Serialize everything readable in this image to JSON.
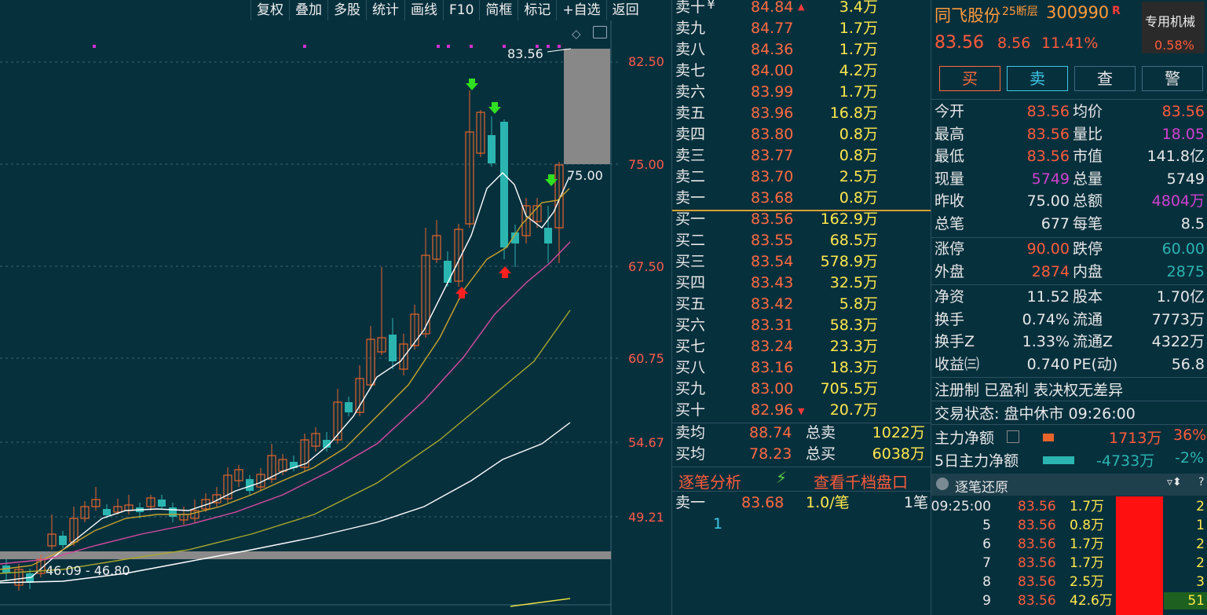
{
  "toolbar": [
    "复权",
    "叠加",
    "多股",
    "统计",
    "画线",
    "F10",
    "简框",
    "标记",
    "+自选",
    "返回"
  ],
  "chart": {
    "y_labels": [
      "82.50",
      "75.00",
      "67.50",
      "60.75",
      "54.67",
      "49.21"
    ],
    "max_label": "83.56",
    "marker_label": "75.00",
    "range_label": "46.09 - 46.80",
    "colors": {
      "up": "#e8642a",
      "down": "#2bb5b0",
      "ma5": "#ffffff",
      "ma10": "#c8a42a",
      "ma20": "#d84aa0",
      "ma30": "#a8a82a",
      "ma60": "#ffffff"
    }
  },
  "chart_data": {
    "type": "candlestick",
    "y_axis_ticks": [
      82.5,
      75.0,
      67.5,
      60.75,
      54.67,
      49.21
    ],
    "max_price": 83.56,
    "close_marker": 75.0,
    "min_range": "46.09 - 46.80"
  },
  "book": {
    "sell": [
      {
        "name": "卖十",
        "px": "84.84",
        "vol": "3.4万"
      },
      {
        "name": "卖九",
        "px": "84.77",
        "vol": "1.7万"
      },
      {
        "name": "卖八",
        "px": "84.36",
        "vol": "1.7万"
      },
      {
        "name": "卖七",
        "px": "84.00",
        "vol": "4.2万"
      },
      {
        "name": "卖六",
        "px": "83.99",
        "vol": "1.7万"
      },
      {
        "name": "卖五",
        "px": "83.96",
        "vol": "16.8万"
      },
      {
        "name": "卖四",
        "px": "83.80",
        "vol": "0.8万"
      },
      {
        "name": "卖三",
        "px": "83.77",
        "vol": "0.8万"
      },
      {
        "name": "卖二",
        "px": "83.70",
        "vol": "2.5万"
      },
      {
        "name": "卖一",
        "px": "83.68",
        "vol": "0.8万"
      }
    ],
    "sell_top_mark": "¥",
    "buy": [
      {
        "name": "买一",
        "px": "83.56",
        "vol": "162.9万"
      },
      {
        "name": "买二",
        "px": "83.55",
        "vol": "68.5万"
      },
      {
        "name": "买三",
        "px": "83.54",
        "vol": "578.9万"
      },
      {
        "name": "买四",
        "px": "83.43",
        "vol": "32.5万"
      },
      {
        "name": "买五",
        "px": "83.42",
        "vol": "5.8万"
      },
      {
        "name": "买六",
        "px": "83.31",
        "vol": "58.3万"
      },
      {
        "name": "买七",
        "px": "83.24",
        "vol": "23.3万"
      },
      {
        "name": "买八",
        "px": "83.16",
        "vol": "18.3万"
      },
      {
        "name": "买九",
        "px": "83.00",
        "vol": "705.5万"
      },
      {
        "name": "买十",
        "px": "82.96",
        "vol": "20.7万"
      }
    ],
    "avg_sell_label": "卖均",
    "avg_sell": "88.74",
    "total_sell_label": "总卖",
    "total_sell": "1022万",
    "avg_buy_label": "买均",
    "avg_buy": "78.23",
    "total_buy_label": "总买",
    "total_buy": "6038万",
    "tab_analysis": "逐笔分析",
    "tab_levels": "查看千档盘口",
    "detail_name": "卖一",
    "detail_px": "83.68",
    "detail_per": "1.0/笔",
    "detail_cnt": "1笔",
    "detail_queue": "1"
  },
  "quote": {
    "name": "同飞股份",
    "tag": "25断层",
    "code": "300990",
    "r_mark": "R",
    "sector": "专用机械",
    "sector_pct": "0.58%",
    "price": "83.56",
    "change": "8.56",
    "pct": "11.41%",
    "buttons": [
      "买",
      "卖",
      "查",
      "警"
    ],
    "stats": [
      [
        "今开",
        "83.56",
        "均价",
        "83.56"
      ],
      [
        "最高",
        "83.56",
        "量比",
        "18.05"
      ],
      [
        "最低",
        "83.56",
        "市值",
        "141.8亿"
      ],
      [
        "现量",
        "5749",
        "总量",
        "5749"
      ],
      [
        "昨收",
        "75.00",
        "总额",
        "4804万"
      ],
      [
        "总笔",
        "677",
        "每笔",
        "8.5"
      ]
    ],
    "limits": [
      [
        "涨停",
        "90.00",
        "跌停",
        "60.00"
      ],
      [
        "外盘",
        "2874",
        "内盘",
        "2875"
      ]
    ],
    "fund": [
      [
        "净资",
        "11.52",
        "股本",
        "1.70亿"
      ],
      [
        "换手",
        "0.74%",
        "流通",
        "7773万"
      ],
      [
        "换手Z",
        "1.33%",
        "流通Z",
        "4322万"
      ],
      [
        "收益㈢",
        "0.740",
        "PE(动)",
        "56.8"
      ]
    ],
    "reg": "注册制 已盈利 表决权无差异",
    "status": "交易状态: 盘中休市 09:26:00",
    "main_net_label": "主力净额",
    "main_net": "1713万",
    "main_net_pct": "36%",
    "main5_label": "5日主力净额",
    "main5": "-4733万",
    "main5_pct": "-2%",
    "ticks_title": "逐笔还原",
    "ticks": [
      {
        "t": "09:25:00",
        "p": "83.56",
        "v": "1.7万",
        "n": "2"
      },
      {
        "t": "5",
        "p": "83.56",
        "v": "0.8万",
        "n": "1"
      },
      {
        "t": "6",
        "p": "83.56",
        "v": "1.7万",
        "n": "2"
      },
      {
        "t": "7",
        "p": "83.56",
        "v": "1.7万",
        "n": "2"
      },
      {
        "t": "8",
        "p": "83.56",
        "v": "2.5万",
        "n": "3"
      },
      {
        "t": "9",
        "p": "83.56",
        "v": "42.6万",
        "n": "51"
      }
    ]
  }
}
